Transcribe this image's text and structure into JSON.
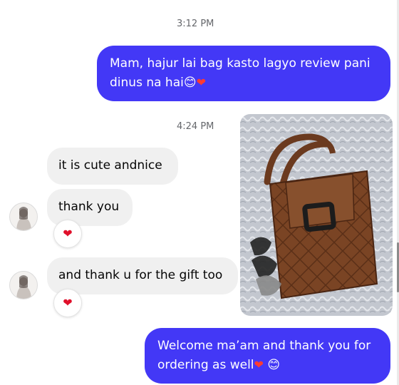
{
  "timestamps": [
    "3:12 PM",
    "4:24 PM"
  ],
  "messages": {
    "out1": "Mam, hajur lai bag kasto lagyo review pani dinus na hai",
    "in1": "it is cute andnice",
    "in2": "thank you",
    "in3": "and thank u for the gift too",
    "out2": "Welcome ma’am and thank you for ordering as well"
  },
  "emoji": {
    "smile": "😊",
    "heart": "❤"
  },
  "reactions": {
    "heart": "❤"
  },
  "colors": {
    "outgoing_bubble": "#4338f6",
    "incoming_bubble": "#f0f0f0",
    "heart": "#e0102b",
    "timestamp": "#65676b"
  },
  "icons": {
    "avatar": "avatar",
    "heart": "heart-icon"
  }
}
